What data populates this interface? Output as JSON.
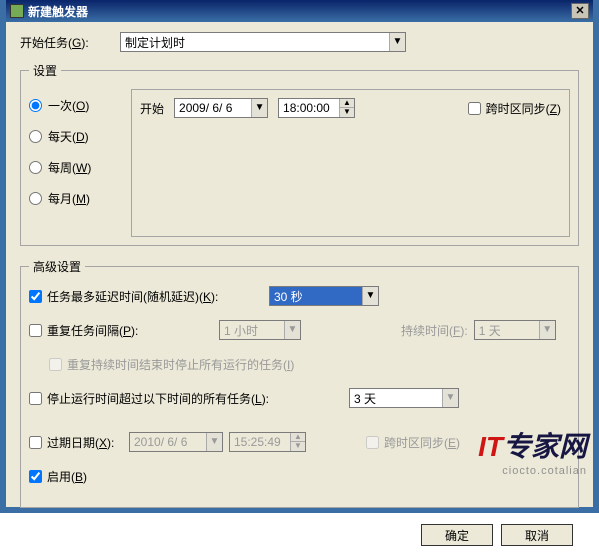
{
  "window": {
    "title": "新建触发器"
  },
  "begin": {
    "label": "开始任务(",
    "mn": "G",
    "after": "):",
    "value": "制定计划时"
  },
  "settings": {
    "legend": "设置",
    "radios": [
      {
        "label": "一次(",
        "mn": "O",
        "after": ")",
        "checked": true
      },
      {
        "label": "每天(",
        "mn": "D",
        "after": ")",
        "checked": false
      },
      {
        "label": "每周(",
        "mn": "W",
        "after": ")",
        "checked": false
      },
      {
        "label": "每月(",
        "mn": "M",
        "after": ")",
        "checked": false
      }
    ],
    "start_label": "开始",
    "date": "2009/ 6/ 6",
    "time": "18:00:00",
    "sync": {
      "label": "跨时区同步(",
      "mn": "Z",
      "after": ")",
      "checked": false
    }
  },
  "adv": {
    "legend": "高级设置",
    "delay": {
      "label": "任务最多延迟时间(随机延迟)(",
      "mn": "K",
      "after": "):",
      "checked": true,
      "value": "30 秒"
    },
    "repeat": {
      "label": "重复任务间隔(",
      "mn": "P",
      "after": "):",
      "checked": false,
      "interval": "1 小时",
      "dur_label": "持续时间(",
      "dur_mn": "F",
      "dur_after": "):",
      "duration": "1 天"
    },
    "stop_repeat": {
      "label": "重复持续时间结束时停止所有运行的任务(",
      "mn": "I",
      "after": ")"
    },
    "stop_after": {
      "label": "停止运行时间超过以下时间的所有任务(",
      "mn": "L",
      "after": "):",
      "checked": false,
      "value": "3 天"
    },
    "expire": {
      "label": "过期日期(",
      "mn": "X",
      "after": "):",
      "checked": false,
      "date": "2010/ 6/ 6",
      "time": "15:25:49",
      "sync_label": "跨时区同步(",
      "sync_mn": "E",
      "sync_after": ")"
    },
    "enabled": {
      "label": "启用(",
      "mn": "B",
      "after": ")",
      "checked": true
    }
  },
  "buttons": {
    "ok": "确定",
    "cancel": "取消"
  },
  "watermark": {
    "big1": "IT",
    "big2": "专家网",
    "small": "ciocto.cotalian"
  }
}
